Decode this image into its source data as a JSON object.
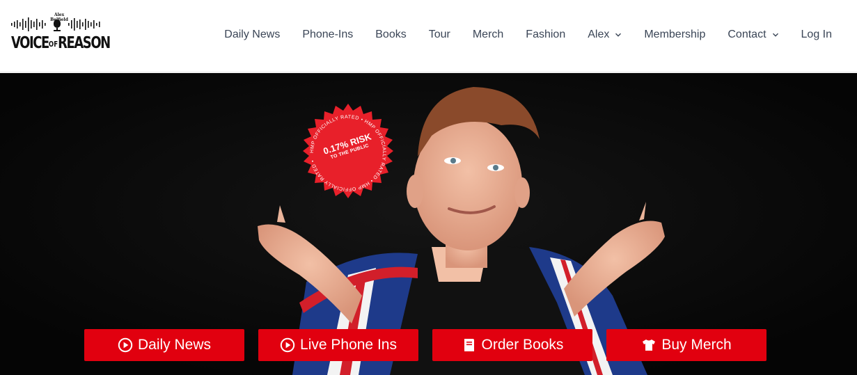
{
  "logo": {
    "tagline": "Alex Belfield",
    "wordmark_left": "VOICE",
    "wordmark_of": "OF",
    "wordmark_right": "REASON"
  },
  "nav": {
    "items": [
      {
        "label": "Daily News"
      },
      {
        "label": "Phone-Ins"
      },
      {
        "label": "Books"
      },
      {
        "label": "Tour"
      },
      {
        "label": "Merch"
      },
      {
        "label": "Fashion"
      },
      {
        "label": "Alex",
        "has_dropdown": true
      },
      {
        "label": "Membership"
      },
      {
        "label": "Contact",
        "has_dropdown": true
      },
      {
        "label": "Log In"
      }
    ]
  },
  "hero": {
    "badge": {
      "risk_text": "0.17% RISK",
      "sub_text": "TO THE PUBLIC",
      "ring_text": "HMP OFFICIALLY RATED • HMP OFFICIALLY RATED • HMP OFFICIALLY RATED •",
      "color": "#e8202a"
    },
    "buttons": [
      {
        "label": "Daily News",
        "icon": "play-circle-icon"
      },
      {
        "label": "Live Phone Ins",
        "icon": "play-circle-icon"
      },
      {
        "label": "Order Books",
        "icon": "book-icon"
      },
      {
        "label": "Buy Merch",
        "icon": "tshirt-icon"
      }
    ],
    "button_color": "#e1000f"
  }
}
